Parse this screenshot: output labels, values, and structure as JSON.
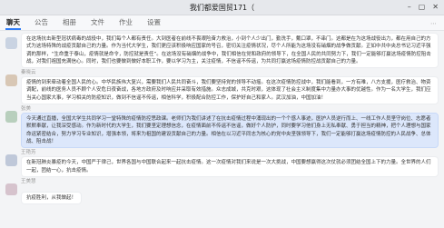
{
  "window": {
    "title": "我们都爱国贸171（"
  },
  "tabs": [
    {
      "label": "聊天",
      "active": true
    },
    {
      "label": "公告",
      "active": false
    },
    {
      "label": "相册",
      "active": false
    },
    {
      "label": "文件",
      "active": false
    },
    {
      "label": "作业",
      "active": false
    },
    {
      "label": "设置",
      "active": false
    }
  ],
  "messages": [
    {
      "sender": "",
      "text": "在这场抗击新型冠状病毒的战役中，我们每个人都有责任。大到医者在前线不畏艰险奋力救治，小到个人少出门，勤洗手，戴口罩，不串门。这都是在为这场战役出力，都在用自己的方式为这场特殊的战疫贡献自己的力量。作为当代大学生，我们更应该积极响应国家的号召，密切关注疫情状况，尽个人所能为这场没有硝烟的战争做贡献。正如中共中央总书记习近平强调的那样，“生命重于泰山，疫情就是命令，防控就是责任”。在这场没有硝烟的战争中，我们相信在党和政府的领导下，在全国人民的共同努力下，我们一定能够打赢这场疫情防控阻击战，对我们祖国充满信心。同时，我们也要做到做好本职工作，要以学习为主，关注疫情，不信谣不传谣，为共同打赢这场疫情防控战贡献自己的力量。"
    },
    {
      "sender": "秦晓云",
      "text": "疫情的到来牵动着全国人民的心。中华民族伟大复兴，需要我们人民共同奋斗，我们要坚持党的领导不动摇。在这次疫情防控战中，我们能看到，一方有难，八方支援，医疗救治、物资调配，前线的医务人员不顾个人安危日夜奋战，各地方政府及时响应并采取有效措施。众志成城，共克时艰，这体现了社会主义制度集中力量办大事的优越性。作为一名大学生，我们应当关心国家大事，学习相关的防疫知识，做到不信谣不传谣，相信科学，积极配合防控工作，保护好自己和家人。武汉加油，中国加油！"
    },
    {
      "sender": "张美",
      "text": "今天通过直播，全国大学生共同学习一堂特殊的疫情防控思政课。老师们为我们讲述了在抗击疫情过程中涌现出的一个个感人事迹，医护人员逆行而上、一线工作人员坚守岗位、志愿者默默奉献，让我深受感动。作为新时代的大学生，我们要坚定理想信念，在疫情面前不传谣不信谣，做好个人防护，同时要学习他们身上无私奉献、勇于担当的精神，把个人理想与国家命运紧密结合，努力学习专业知识，增强本领，将来为祖国的建设贡献自己的力量。相信在以习近平同志为核心的党中央坚强领导下，我们一定能够打赢这场疫情防控的人民战争、总体战、阻击战！",
      "selected": true
    },
    {
      "sender": "王艳芳",
      "text": "在新冠肺炎暴疫的今天，中国严于律己，世界各国与中国联合起来一起抗击疫情。这一次疫情对我们来说是一次大挑战，中国要想赢得这次仗就必须团结全国上下的力量。全世界的人们一起，团结一心，抗击疫情。"
    },
    {
      "sender": "王美慧",
      "text": "抗疫胜利，从我做起！"
    }
  ]
}
